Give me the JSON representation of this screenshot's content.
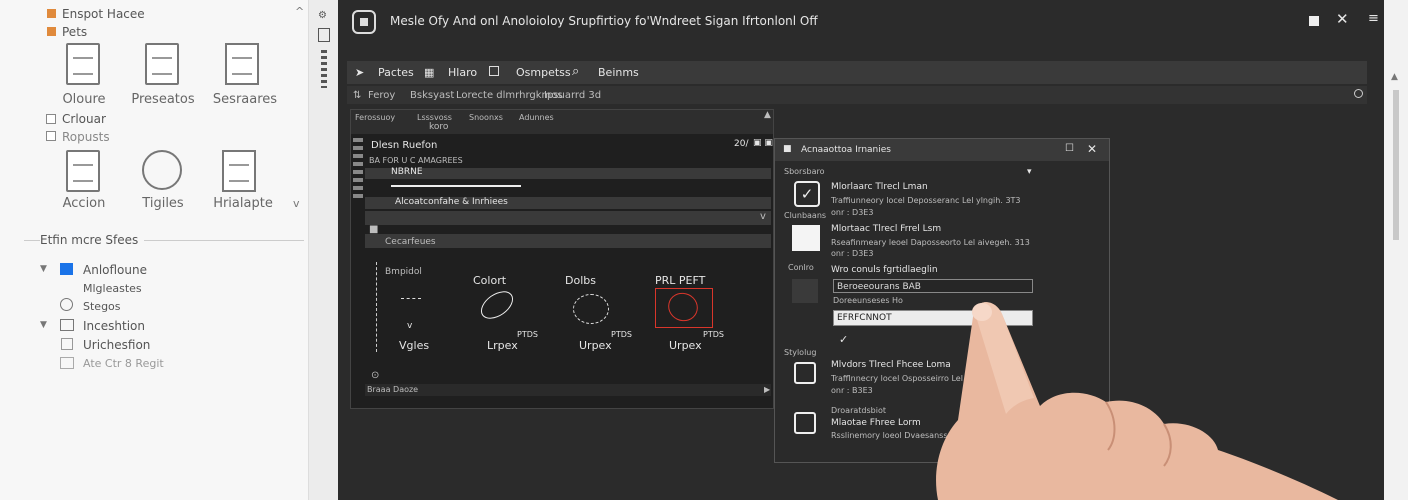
{
  "left_panel": {
    "items_top": [
      "Enspot Hacee",
      "Pets"
    ],
    "large_icons_row1": [
      "Oloure",
      "Preseatos",
      "Sesraares"
    ],
    "checks": [
      "Crlouar",
      "Ropusts"
    ],
    "large_icons_row2": [
      "Accion",
      "Tigiles",
      "Hrialapte"
    ],
    "section_title": "Etfin mcre Sfees",
    "tree": [
      "Anlofloune",
      "Mlgleastes",
      "Stegos",
      "Inceshtion",
      "Urichesfion",
      "Ate Ctr 8 Regit"
    ]
  },
  "window": {
    "title": "Mesle Ofy And onl Anoloioloy Srupfirtioy fo'Wndreet Sigan Ifrtonlonl Off",
    "toolbar": [
      "Pactes",
      "Hlaro",
      "Osmpetss",
      "Beinms"
    ],
    "path_bar": [
      "Feroy",
      "Bsksyast",
      "Lorecte dlmrhrgkmos",
      "Ipsuarrd 3d"
    ]
  },
  "editor": {
    "tabs": [
      "Ferossuoy",
      "Lsssvoss",
      "Snoonxs",
      "Adunnes"
    ],
    "tab_sub": "koro",
    "title": "Dlesn Ruefon",
    "subtitle": "BA FOR U C AMAGREES",
    "page": "20/",
    "row1": "NBRNE",
    "row2": "Alcoatconfahe & Inrhiees",
    "section": "Cecarfeues",
    "shapes": [
      "Bmpidol",
      "Colort",
      "Dolbs",
      "PRL PEFT"
    ],
    "labels": [
      "Vgles",
      "Lrpex",
      "Urpex",
      "Urpex"
    ],
    "tags": [
      "PTDS",
      "PTDS",
      "PTDS"
    ],
    "footer": "Braaa Daoze"
  },
  "dialog": {
    "title": "Acnaaottoa Irnanies",
    "section1": "Sborsbaro",
    "entries": [
      {
        "title": "Mlorlaarc Tlrecl Lman",
        "desc": "Traffiunneory locel Deposseranc Lel ylngih. 3T3",
        "extra": "onr : D3E3"
      },
      {
        "title": "Mlortaac Tlrecl Frrel Lsm",
        "desc": "Rseafinmeary leoel Daposseorto Lel aivegeh. 313",
        "extra": "onr : D3E3"
      }
    ],
    "left_labels": [
      "Clunbaans",
      "Conlro",
      "Stylolug"
    ],
    "field_label": "Wro conuls fgrtidlaeglin",
    "field1": "Beroeeourans BAB",
    "field_label2": "Doreeunseses Ho",
    "field2": "EFRFCNNOT",
    "entries2": [
      {
        "title": "Mlvdors Tlrecl Fhcee Loma",
        "desc": "Trafflnnecry locel Osposseirro Lel alogeh. 1J3",
        "extra": "onr : B3E3"
      },
      {
        "title": "Mlaotae Fhree Lorm",
        "desc": "Rsslinemory loeol Dvaesanss Lel alocnet. 2S3",
        "extra": "Droaratdsbiot"
      }
    ]
  }
}
